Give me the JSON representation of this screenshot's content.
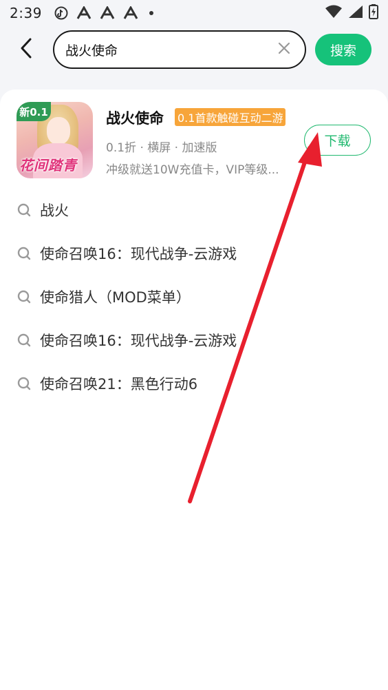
{
  "status_bar": {
    "time": "2:39"
  },
  "search": {
    "query": "战火使命",
    "button_label": "搜索"
  },
  "game": {
    "icon_badge": "新0.1",
    "icon_caption": "花间踏青",
    "title": "战火使命",
    "tag": "0.1首款触碰互动二游",
    "meta": "0.1折 · 横屏 · 加速版",
    "description": "冲级就送10W充值卡，VIP等级...",
    "download_label": "下载"
  },
  "suggestions": [
    {
      "label": "战火"
    },
    {
      "label": "使命召唤16：现代战争-云游戏"
    },
    {
      "label": "使命猎人（MOD菜单）"
    },
    {
      "label": "使命召唤16：现代战争-云游戏"
    },
    {
      "label": "使命召唤21：黑色行动6"
    }
  ],
  "colors": {
    "accent_green": "#16c27a",
    "tag_orange": "#f7a53a",
    "annotation_red": "#e8202e"
  }
}
